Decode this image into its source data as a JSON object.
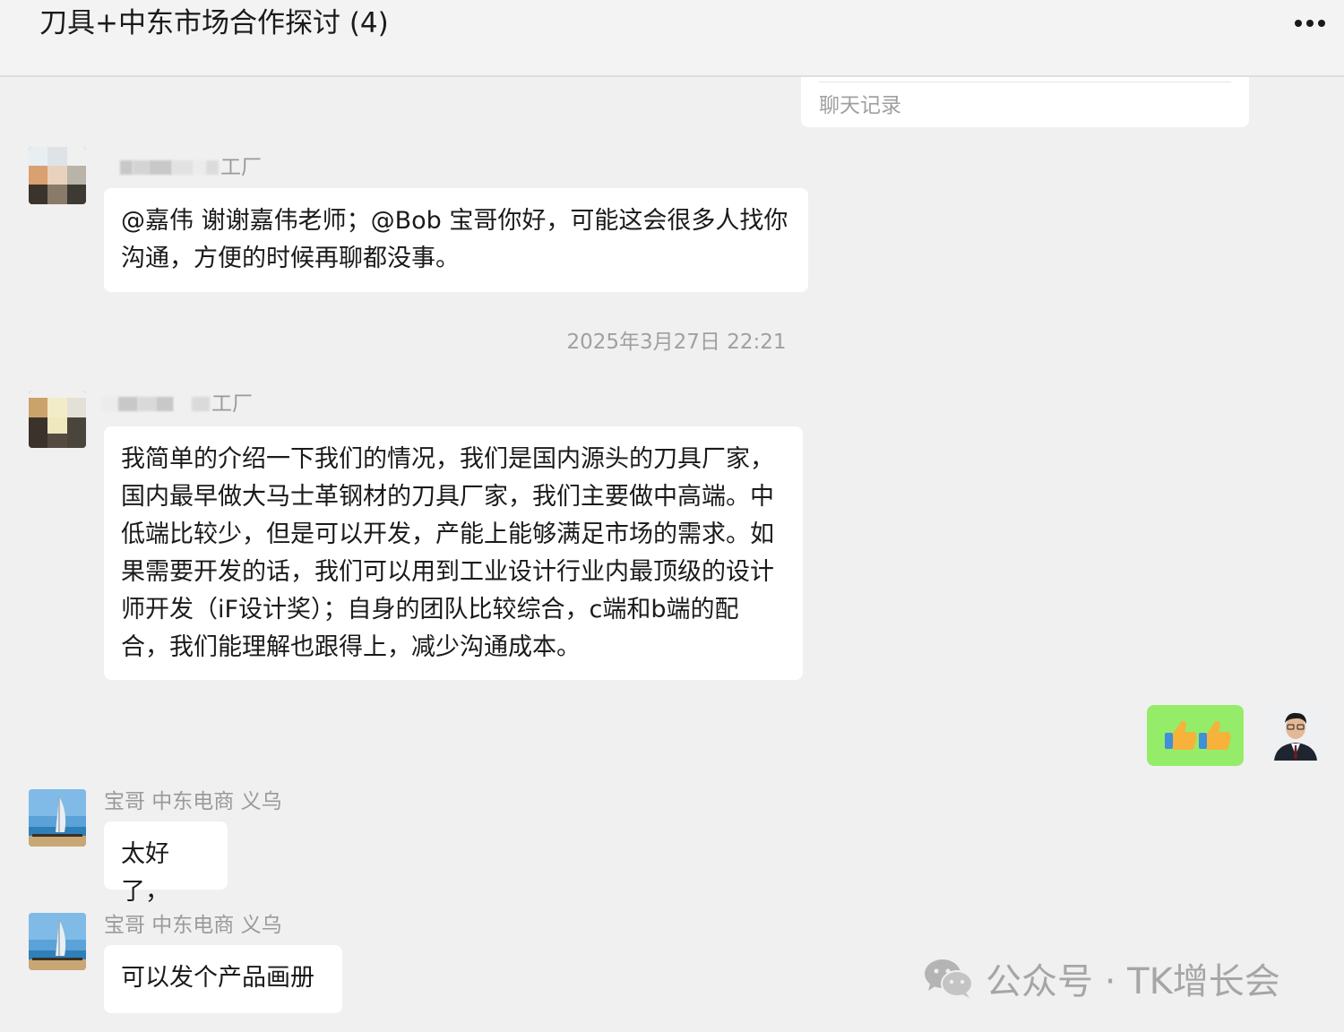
{
  "header": {
    "title": "刀具+中东市场合作探讨 (4)",
    "more_icon": "more-dots-icon"
  },
  "history_card": {
    "label": "聊天记录"
  },
  "messages": [
    {
      "sender": "工厂",
      "sender_blurred": true,
      "text": "@嘉伟 谢谢嘉伟老师；@Bob 宝哥你好，可能这会很多人找你沟通，方便的时候再聊都没事。"
    },
    {
      "sender": "工厂",
      "sender_blurred": true,
      "text": "我简单的介绍一下我们的情况，我们是国内源头的刀具厂家，国内最早做大马士革钢材的刀具厂家，我们主要做中高端。中低端比较少，但是可以开发，产能上能够满足市场的需求。如果需要开发的话，我们可以用到工业设计行业内最顶级的设计师开发（iF设计奖）；自身的团队比较综合，c端和b端的配合，我们能理解也跟得上，减少沟通成本。"
    },
    {
      "self": true,
      "text": "👍👍",
      "content_icon": "thumbs-up-icon"
    },
    {
      "sender": "宝哥 中东电商 义乌",
      "text": "太好了，"
    },
    {
      "sender": "宝哥 中东电商 义乌",
      "text": "可以发个产品画册"
    }
  ],
  "timestamp": "2025年3月27日 22:21",
  "watermark": {
    "icon": "wechat-icon",
    "text": "公众号 · TK增长会"
  },
  "colors": {
    "background": "#f0f0f0",
    "bubble_incoming": "#ffffff",
    "bubble_outgoing": "#95ec69",
    "muted_text": "#a0a0a0"
  }
}
